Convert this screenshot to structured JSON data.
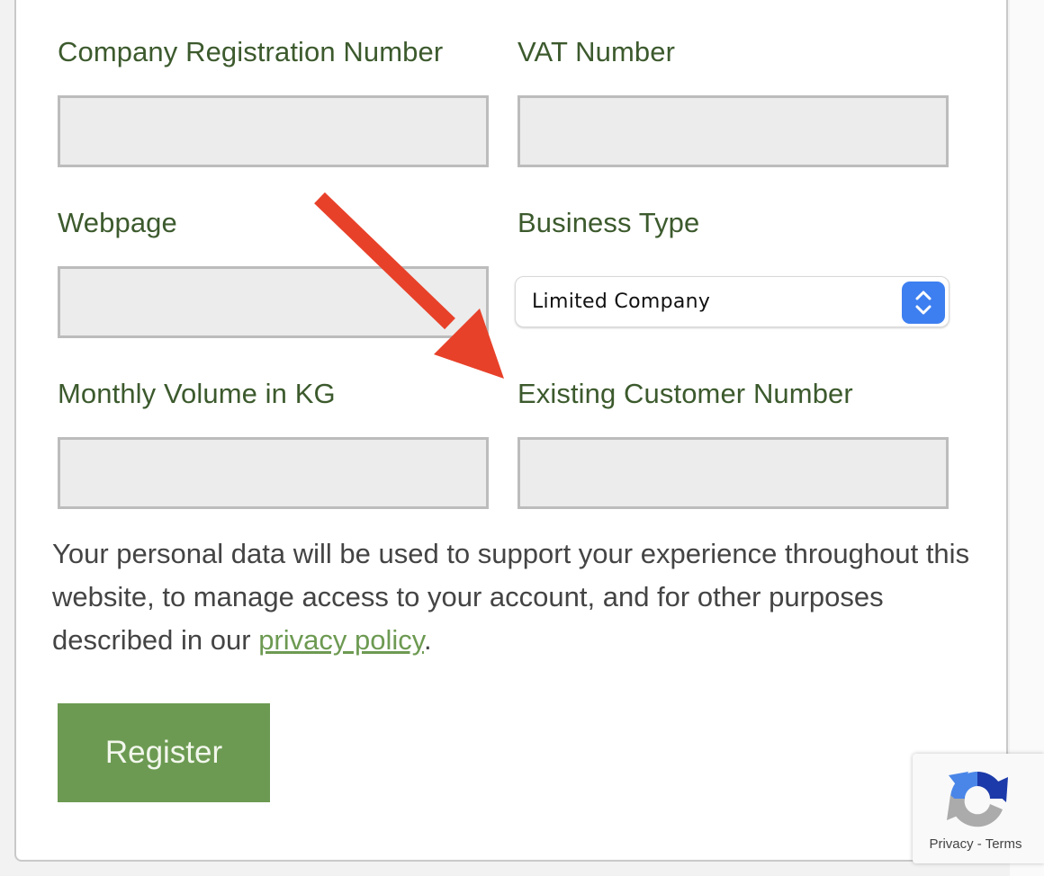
{
  "form": {
    "fields": [
      {
        "label": "Company Registration Number",
        "value": "",
        "placeholder": ""
      },
      {
        "label": "VAT Number",
        "value": "",
        "placeholder": ""
      },
      {
        "label": "Webpage",
        "value": "",
        "placeholder": ""
      },
      {
        "label": "Business Type",
        "selected": "Limited Company"
      },
      {
        "label": "Monthly Volume in KG",
        "value": "",
        "placeholder": ""
      },
      {
        "label": "Existing Customer Number",
        "value": "",
        "placeholder": ""
      }
    ],
    "notice_text": "Your personal data will be used to support your experience throughout this website, to manage access to your account, and for other purposes described in our ",
    "privacy_link": "privacy policy",
    "notice_end": ".",
    "register_label": "Register"
  },
  "recaptcha": {
    "privacy": "Privacy",
    "separator": " - ",
    "terms": "Terms"
  },
  "annotation": {
    "arrow_color": "#e8412a",
    "points_to": "Existing Customer Number"
  },
  "colors": {
    "label": "#3c5a2d",
    "accent": "#6c9a52",
    "select_button": "#3d7ff0"
  }
}
